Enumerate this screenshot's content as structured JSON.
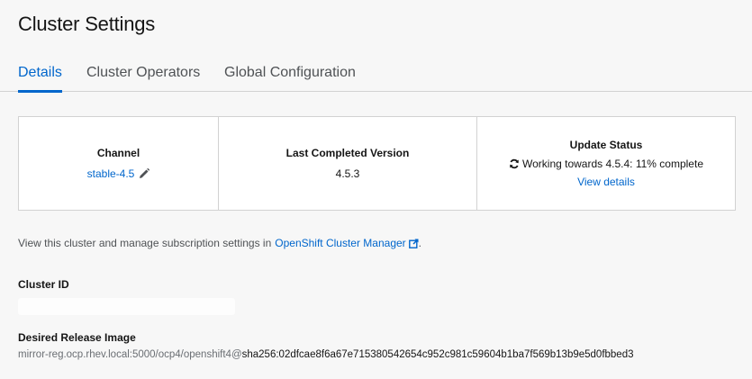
{
  "page": {
    "title": "Cluster Settings"
  },
  "tabs": [
    {
      "label": "Details",
      "active": true
    },
    {
      "label": "Cluster Operators",
      "active": false
    },
    {
      "label": "Global Configuration",
      "active": false
    }
  ],
  "details": {
    "channel": {
      "label": "Channel",
      "value": "stable-4.5",
      "icon": "pencil-icon"
    },
    "last_completed_version": {
      "label": "Last Completed Version",
      "value": "4.5.3"
    },
    "update_status": {
      "label": "Update Status",
      "icon": "sync-icon",
      "text": "Working towards 4.5.4: 11% complete",
      "link": "View details"
    }
  },
  "info": {
    "text": "View this cluster and manage subscription settings in",
    "link": "OpenShift Cluster Manager",
    "suffix": ".",
    "icon": "external-link-icon"
  },
  "cluster_id": {
    "label": "Cluster ID",
    "value": ""
  },
  "desired_release_image": {
    "label": "Desired Release Image",
    "prefix": "mirror-reg.ocp.rhev.local:5000/ocp4/openshift4@",
    "hash": "sha256:02dfcae8f6a67e715380542654c952c981c59604b1ba7f569b13b9e5d0fbbed3"
  },
  "colors": {
    "accent": "#0066cc",
    "background": "#f7f7f7",
    "card_border": "#d2d2d2"
  }
}
